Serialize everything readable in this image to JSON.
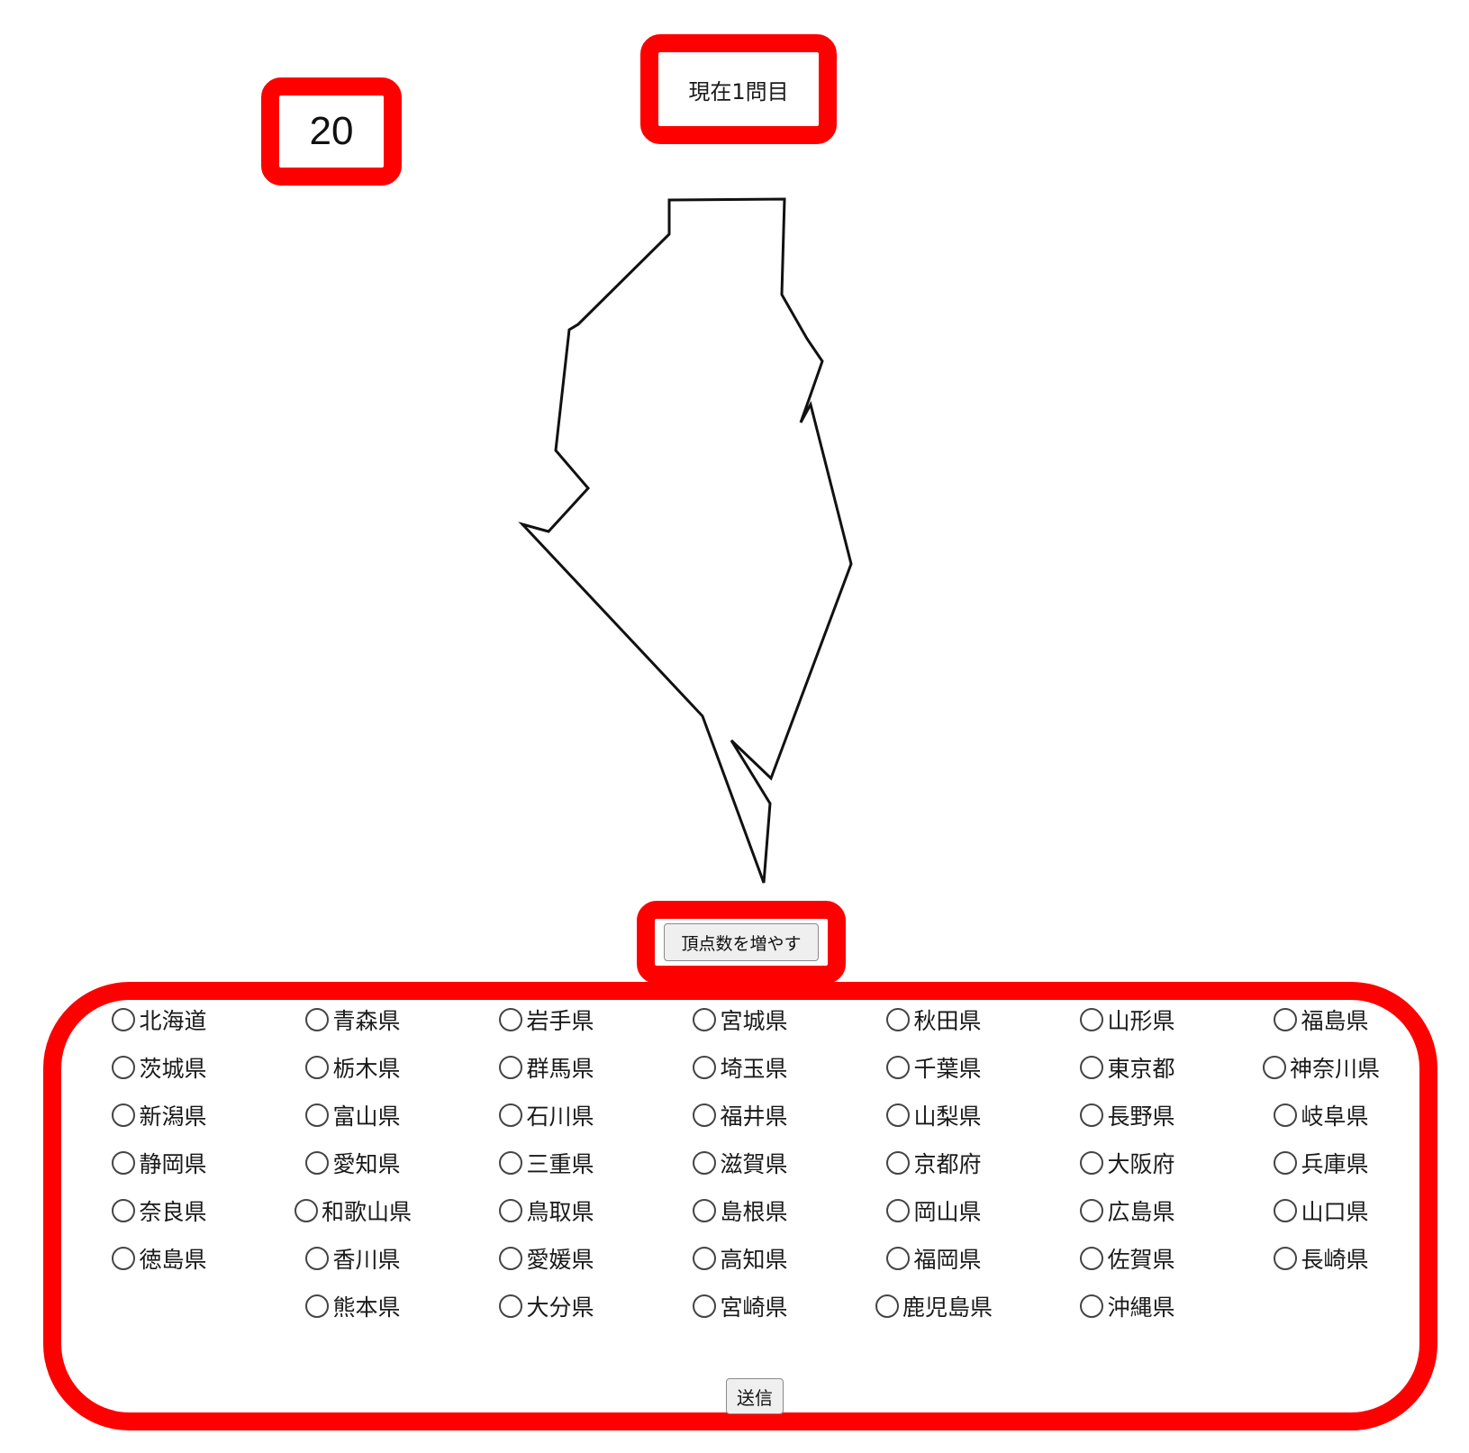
{
  "score": {
    "value": "20"
  },
  "question": {
    "text": "現在1問目"
  },
  "shape": {
    "icon": "prefecture-outline-shape"
  },
  "controls": {
    "increase_vertices_label": "頂点数を増やす",
    "submit_label": "送信"
  },
  "colors": {
    "accent": "#fe0000",
    "outline": "#111111",
    "button_bg": "#efefef"
  },
  "prefectures": [
    [
      "北海道",
      "青森県",
      "岩手県",
      "宮城県",
      "秋田県",
      "山形県",
      "福島県"
    ],
    [
      "茨城県",
      "栃木県",
      "群馬県",
      "埼玉県",
      "千葉県",
      "東京都",
      "神奈川県"
    ],
    [
      "新潟県",
      "富山県",
      "石川県",
      "福井県",
      "山梨県",
      "長野県",
      "岐阜県"
    ],
    [
      "静岡県",
      "愛知県",
      "三重県",
      "滋賀県",
      "京都府",
      "大阪府",
      "兵庫県"
    ],
    [
      "奈良県",
      "和歌山県",
      "鳥取県",
      "島根県",
      "岡山県",
      "広島県",
      "山口県"
    ],
    [
      "徳島県",
      "香川県",
      "愛媛県",
      "高知県",
      "福岡県",
      "佐賀県",
      "長崎県"
    ],
    [
      "",
      "熊本県",
      "大分県",
      "宮崎県",
      "鹿児島県",
      "沖縄県",
      ""
    ]
  ]
}
